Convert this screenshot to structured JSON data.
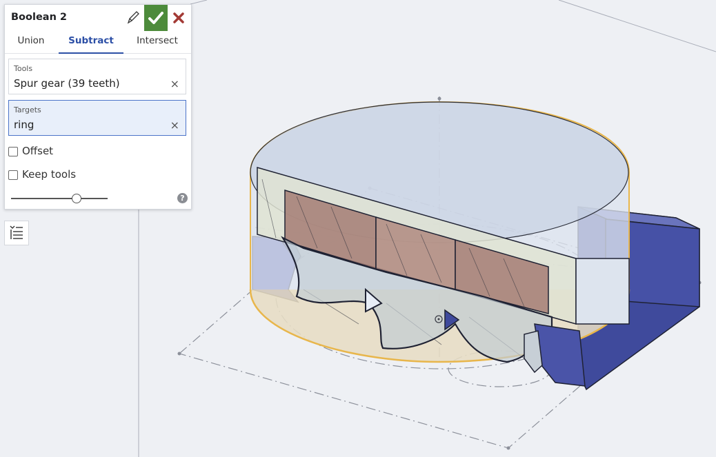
{
  "dialog": {
    "title": "Boolean 2",
    "tabs": [
      "Union",
      "Subtract",
      "Intersect"
    ],
    "active_tab": "Subtract",
    "tools": {
      "label": "Tools",
      "value": "Spur gear (39 teeth)",
      "clear": "×"
    },
    "targets": {
      "label": "Targets",
      "value": "ring",
      "clear": "×"
    },
    "offset": {
      "label": "Offset",
      "checked": false
    },
    "keep_tools": {
      "label": "Keep tools",
      "checked": false
    },
    "slider_fraction": 0.68,
    "help": "?"
  },
  "icons": {
    "edit": "pencil-icon",
    "accept": "checkmark-icon",
    "cancel": "close-icon",
    "help": "question-icon",
    "feature_list": "feature-list-icon"
  },
  "colors": {
    "accent": "#2c4fa6",
    "accept_green": "#4d8b3b",
    "cancel_red": "#a33a35",
    "selection_orange": "#e8b64b",
    "part_blue": "#4a54a8"
  }
}
